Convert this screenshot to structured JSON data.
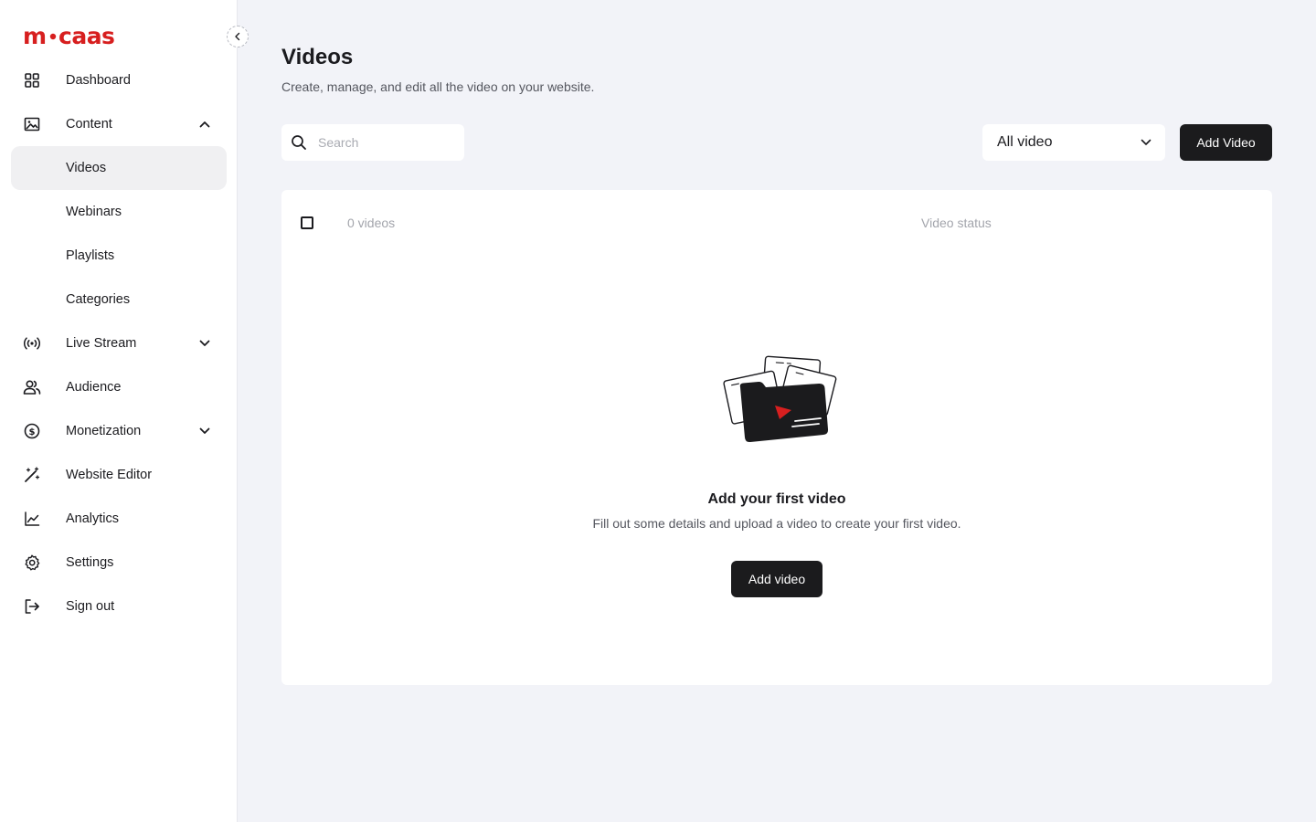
{
  "app": {
    "logo_text": "m•caas",
    "brand_color": "#d71f1f"
  },
  "sidebar": {
    "items": [
      {
        "label": "Dashboard",
        "icon": "grid-icon"
      },
      {
        "label": "Content",
        "icon": "image-icon",
        "expanded": true
      },
      {
        "label": "Videos",
        "active": true
      },
      {
        "label": "Webinars"
      },
      {
        "label": "Playlists"
      },
      {
        "label": "Categories"
      },
      {
        "label": "Live Stream",
        "icon": "broadcast-icon",
        "expanded": false
      },
      {
        "label": "Audience",
        "icon": "users-icon"
      },
      {
        "label": "Monetization",
        "icon": "dollar-icon",
        "expanded": false
      },
      {
        "label": "Website Editor",
        "icon": "magic-wand-icon"
      },
      {
        "label": "Analytics",
        "icon": "chart-line-icon"
      },
      {
        "label": "Settings",
        "icon": "gear-icon"
      },
      {
        "label": "Sign out",
        "icon": "sign-out-icon"
      }
    ]
  },
  "page": {
    "title": "Videos",
    "subtitle": "Create, manage, and edit all the video on your website."
  },
  "toolbar": {
    "search_placeholder": "Search",
    "filter_value": "All video",
    "add_button_label": "Add Video"
  },
  "table": {
    "count_label": "0 videos",
    "status_header": "Video status"
  },
  "empty_state": {
    "title": "Add your first video",
    "description": "Fill out some details and upload a video to create your first video.",
    "button_label": "Add video"
  },
  "colors": {
    "background": "#f2f3f8",
    "surface": "#ffffff",
    "dark_button": "#1b1b1d",
    "accent_red": "#d71f1f"
  }
}
